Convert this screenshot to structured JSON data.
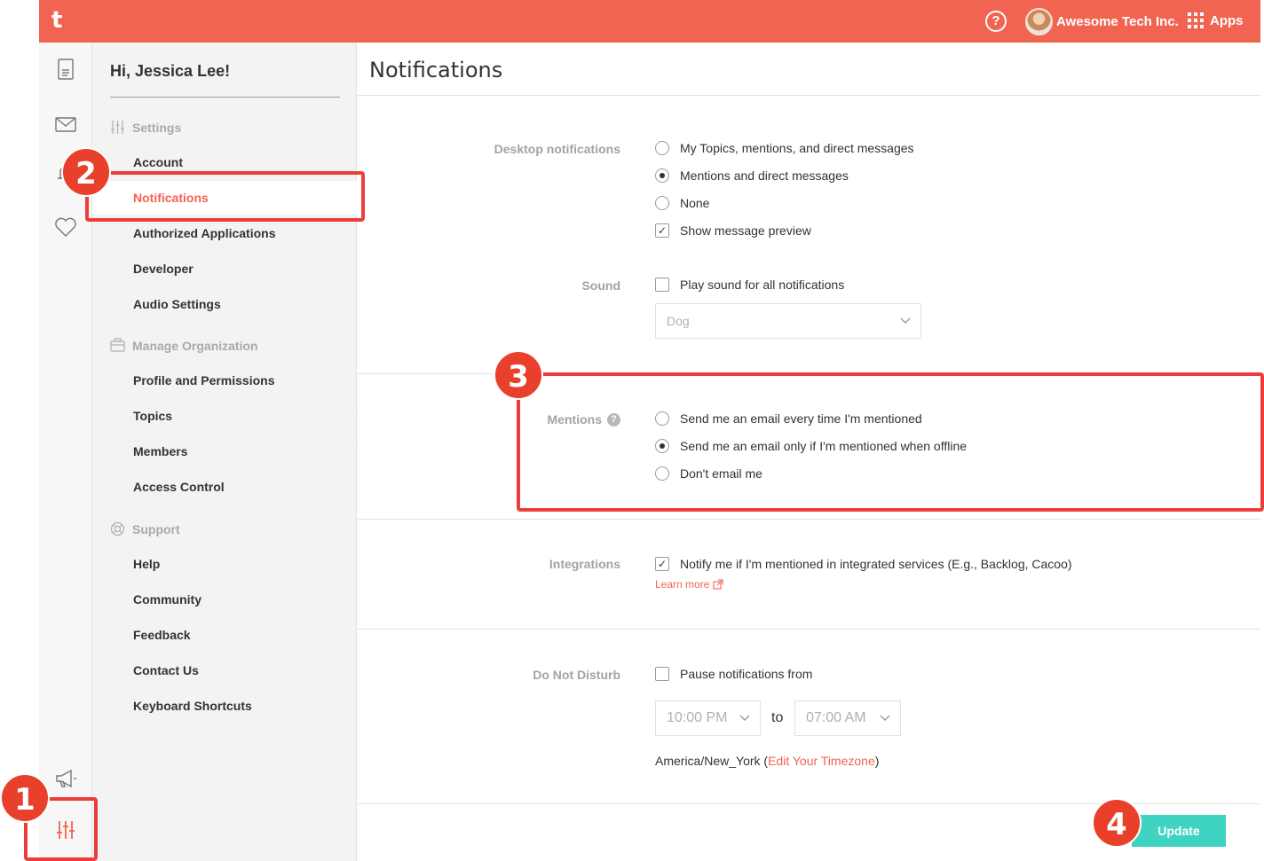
{
  "topbar": {
    "logo": "t",
    "help_icon": "question-circle-icon",
    "org_name": "Awesome Tech Inc.",
    "apps_label": "Apps",
    "accent_color": "#f26452"
  },
  "rail": {
    "icons": [
      "document-icon",
      "mail-icon",
      "bell-icon",
      "heart-icon",
      "megaphone-icon",
      "settings-sliders-icon"
    ]
  },
  "sidebar": {
    "greeting": "Hi, Jessica Lee!",
    "sections": [
      {
        "title": "Settings",
        "icon": "sliders-icon",
        "items": [
          "Account",
          "Notifications",
          "Authorized Applications",
          "Developer",
          "Audio Settings"
        ]
      },
      {
        "title": "Manage Organization",
        "icon": "organization-icon",
        "items": [
          "Profile and Permissions",
          "Topics",
          "Members",
          "Access Control"
        ]
      },
      {
        "title": "Support",
        "icon": "lifebuoy-icon",
        "items": [
          "Help",
          "Community",
          "Feedback",
          "Contact Us",
          "Keyboard Shortcuts"
        ]
      }
    ],
    "active_item": "Notifications"
  },
  "main": {
    "title": "Notifications",
    "desktop": {
      "label": "Desktop notifications",
      "options": [
        "My Topics, mentions, and direct messages",
        "Mentions and direct messages",
        "None"
      ],
      "selected": 1,
      "preview_label": "Show message preview",
      "preview_checked": true
    },
    "sound": {
      "label": "Sound",
      "play_label": "Play sound for all notifications",
      "play_checked": false,
      "select_value": "Dog"
    },
    "mentions": {
      "label": "Mentions",
      "options": [
        "Send me an email every time I'm mentioned",
        "Send me an email only if I'm mentioned when offline",
        "Don't email me"
      ],
      "selected": 1
    },
    "integrations": {
      "label": "Integrations",
      "notify_label": "Notify me if I'm mentioned in integrated services (E.g., Backlog, Cacoo)",
      "notify_checked": true,
      "learn_more": "Learn more"
    },
    "dnd": {
      "label": "Do Not Disturb",
      "pause_label": "Pause notifications from",
      "pause_checked": false,
      "from": "10:00 PM",
      "to_label": "to",
      "to": "07:00 AM",
      "timezone": "America/New_York",
      "tz_open": " (",
      "edit_tz": "Edit Your Timezone",
      "tz_close": ")"
    },
    "update_label": "Update"
  },
  "annotations": [
    "1",
    "2",
    "3",
    "4"
  ],
  "annotation_color": "#ec3d3b"
}
